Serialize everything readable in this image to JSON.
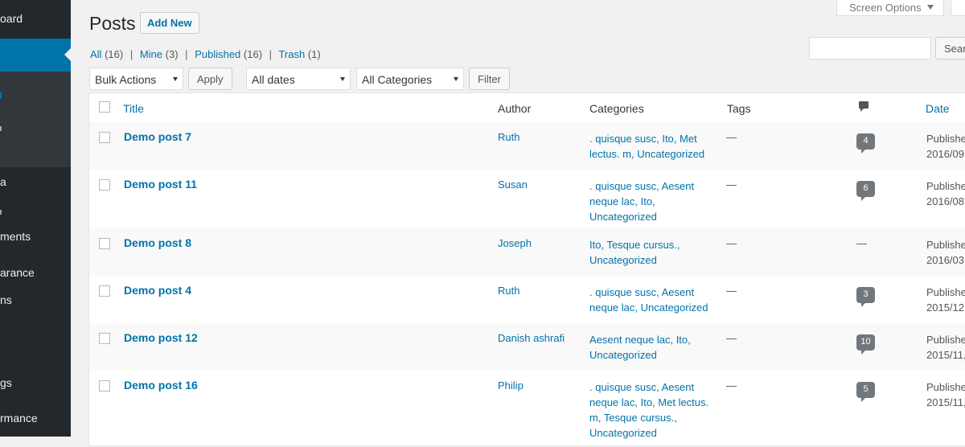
{
  "sidebar": {
    "items": [
      {
        "label": "oard",
        "top": 0
      },
      {
        "label": "a"
      },
      {
        "label": "ments"
      },
      {
        "label": "arance"
      },
      {
        "label": "ns"
      },
      {
        "label": "gs"
      },
      {
        "label": "rmance"
      }
    ]
  },
  "header": {
    "title": "Posts",
    "add_new_label": "Add New",
    "screen_options_label": "Screen Options",
    "search_button_label": "Search Posts"
  },
  "views": {
    "all": {
      "label": "All",
      "count": "(16)"
    },
    "mine": {
      "label": "Mine",
      "count": "(3)"
    },
    "published": {
      "label": "Published",
      "count": "(16)"
    },
    "trash": {
      "label": "Trash",
      "count": "(1)"
    },
    "separator": "|"
  },
  "filters": {
    "bulk_actions": "Bulk Actions",
    "apply_label": "Apply",
    "dates": "All dates",
    "categories": "All Categories",
    "filter_label": "Filter"
  },
  "table": {
    "columns": {
      "title": "Title",
      "author": "Author",
      "categories": "Categories",
      "tags": "Tags",
      "date": "Date"
    },
    "rows": [
      {
        "title": "Demo post 7",
        "author": "Ruth",
        "categories": ". quisque susc, Ito, Met lectus. m, Uncategorized",
        "tags": "—",
        "comments": "4",
        "status": "Publishe",
        "date": "2016/09,"
      },
      {
        "title": "Demo post 11",
        "author": "Susan",
        "categories": ". quisque susc, Aesent neque lac, Ito, Uncategorized",
        "tags": "—",
        "comments": "6",
        "status": "Publishe",
        "date": "2016/08,"
      },
      {
        "title": "Demo post 8",
        "author": "Joseph",
        "categories": "Ito, Tesque cursus., Uncategorized",
        "tags": "—",
        "comments": "—",
        "status": "Publishe",
        "date": "2016/03,"
      },
      {
        "title": "Demo post 4",
        "author": "Ruth",
        "categories": ". quisque susc, Aesent neque lac, Uncategorized",
        "tags": "—",
        "comments": "3",
        "status": "Publishe",
        "date": "2015/12,"
      },
      {
        "title": "Demo post 12",
        "author": "Danish ashrafi",
        "categories": "Aesent neque lac, Ito, Uncategorized",
        "tags": "—",
        "comments": "10",
        "status": "Publishe",
        "date": "2015/11,"
      },
      {
        "title": "Demo post 16",
        "author": "Philip",
        "categories": ". quisque susc, Aesent neque lac, Ito, Met lectus. m, Tesque cursus., Uncategorized",
        "tags": "—",
        "comments": "5",
        "status": "Publishe",
        "date": "2015/11,"
      }
    ]
  },
  "colors": {
    "accent": "#0073aa",
    "sidebar": "#23282d",
    "sidebar_sub": "#32373c",
    "background": "#f1f1f1",
    "comment_bubble": "#72777c"
  }
}
